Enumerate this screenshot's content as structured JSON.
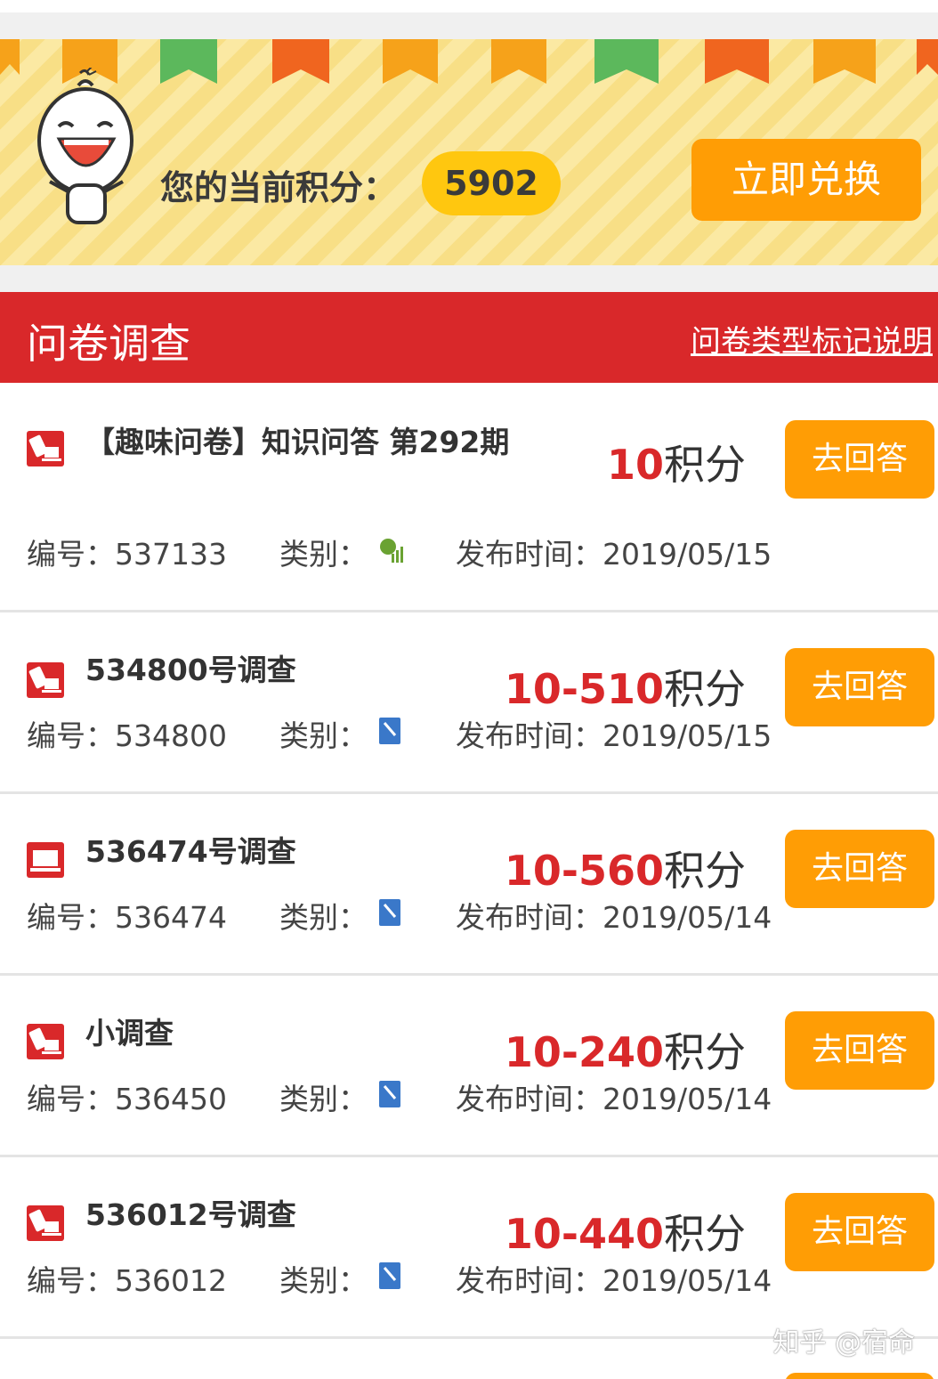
{
  "banner": {
    "score_label": "您的当前积分：",
    "score_value": "5902",
    "redeem_label": "立即兑换"
  },
  "section": {
    "title": "问卷调查",
    "legend_link": "问卷类型标记说明"
  },
  "surveys": [
    {
      "title": "【趣味问卷】知识问答 第292期",
      "points_num": "10",
      "points_unit": "积分",
      "answer_label": "去回答",
      "id_label": "编号：",
      "id": "537133",
      "category_label": "类别：",
      "category_icon": "chart-icon",
      "date_label": "发布时间：",
      "date": "2019/05/15",
      "type_icon": "mobile-pc-icon"
    },
    {
      "title": "534800号调查",
      "points_num": "10-510",
      "points_unit": "积分",
      "answer_label": "去回答",
      "id_label": "编号：",
      "id": "534800",
      "category_label": "类别：",
      "category_icon": "document-icon",
      "date_label": "发布时间：",
      "date": "2019/05/15",
      "type_icon": "mobile-pc-icon"
    },
    {
      "title": "536474号调查",
      "points_num": "10-560",
      "points_unit": "积分",
      "answer_label": "去回答",
      "id_label": "编号：",
      "id": "536474",
      "category_label": "类别：",
      "category_icon": "document-icon",
      "date_label": "发布时间：",
      "date": "2019/05/14",
      "type_icon": "pc-icon"
    },
    {
      "title": "小调查",
      "points_num": "10-240",
      "points_unit": "积分",
      "answer_label": "去回答",
      "id_label": "编号：",
      "id": "536450",
      "category_label": "类别：",
      "category_icon": "document-icon",
      "date_label": "发布时间：",
      "date": "2019/05/14",
      "type_icon": "mobile-pc-icon"
    },
    {
      "title": "536012号调查",
      "points_num": "10-440",
      "points_unit": "积分",
      "answer_label": "去回答",
      "id_label": "编号：",
      "id": "536012",
      "category_label": "类别：",
      "category_icon": "document-icon",
      "date_label": "发布时间：",
      "date": "2019/05/14",
      "type_icon": "mobile-pc-icon"
    }
  ],
  "watermark": "知乎 @宿命",
  "colors": {
    "accent_red": "#d9282a",
    "button_orange": "#ff9d05",
    "score_yellow": "#ffc70f"
  }
}
